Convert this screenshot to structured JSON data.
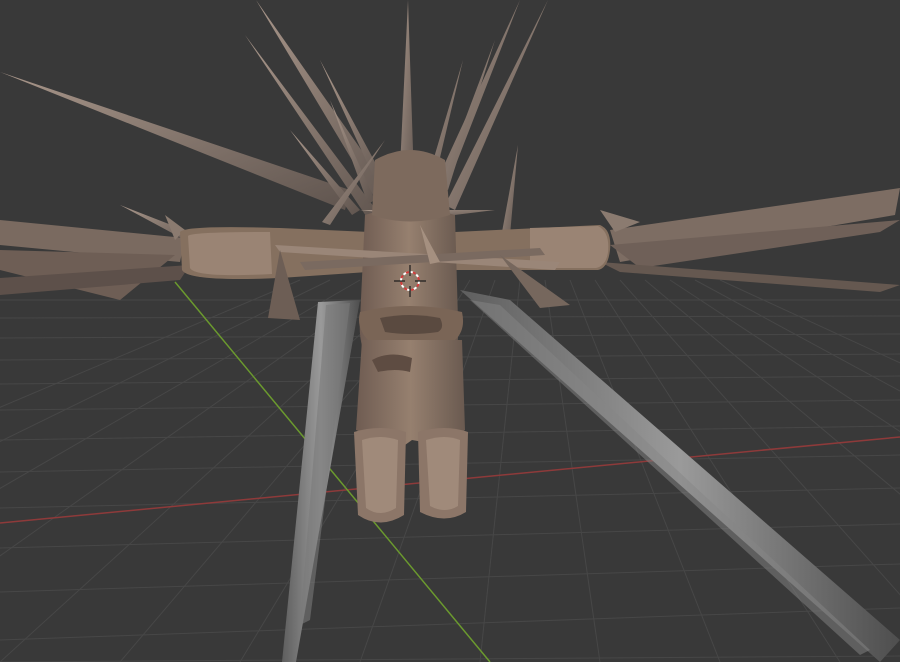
{
  "viewport": {
    "kind": "3d-viewport",
    "background_color": "#393939",
    "grid_color": "#4a4a4a",
    "x_axis_color": "#9a3a3a",
    "y_axis_color": "#6a9a2a",
    "mesh_color": "#8c7668",
    "spike_color": "#8a7f78",
    "cursor_icon": "3d-cursor-icon",
    "cursor_colors": [
      "#d23c3c",
      "#ffffff"
    ]
  }
}
